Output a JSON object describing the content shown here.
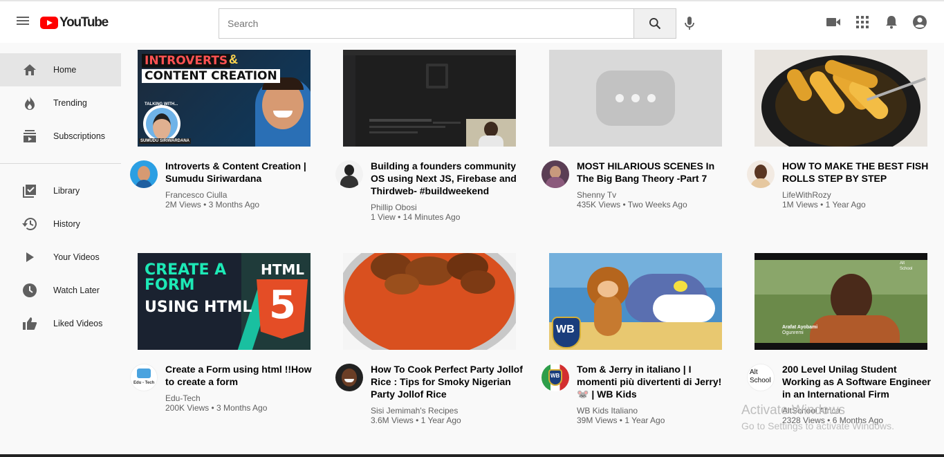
{
  "header": {
    "logo_text": "YouTube",
    "search_placeholder": "Search"
  },
  "sidebar": {
    "items": [
      {
        "label": "Home",
        "icon": "home-icon"
      },
      {
        "label": "Trending",
        "icon": "fire-icon"
      },
      {
        "label": "Subscriptions",
        "icon": "subscriptions-icon"
      },
      {
        "label": "Library",
        "icon": "library-icon"
      },
      {
        "label": "History",
        "icon": "history-icon"
      },
      {
        "label": "Your Videos",
        "icon": "play-icon"
      },
      {
        "label": "Watch Later",
        "icon": "clock-icon"
      },
      {
        "label": "Liked Videos",
        "icon": "thumbs-up-icon"
      }
    ]
  },
  "videos": [
    {
      "title": "Introverts & Content Creation | Sumudu Siriwardana",
      "channel": "Francesco Ciulla",
      "stats": "2M Views • 3 Months Ago"
    },
    {
      "title": "Building a founders community OS using Next JS, Firebase and Thirdweb- #buildweekend",
      "channel": "Phillip Obosi",
      "stats": "1 View • 14 Minutes Ago"
    },
    {
      "title": "MOST HILARIOUS SCENES In The Big Bang Theory -Part 7",
      "channel": "Shenny Tv",
      "stats": "435K Views • Two Weeks Ago"
    },
    {
      "title": "HOW TO MAKE THE BEST FISH ROLLS STEP BY STEP",
      "channel": "LifeWithRozy",
      "stats": "1M Views • 1 Year Ago"
    },
    {
      "title": "Create a Form using html !!How to create a form",
      "channel": "Edu-Tech",
      "stats": "200K Views • 3 Months Ago"
    },
    {
      "title": "How To Cook Perfect Party Jollof Rice : Tips for Smoky Nigerian Party Jollof Rice",
      "channel": "Sisi Jemimah's Recipes",
      "stats": "3.6M Views • 1 Year Ago"
    },
    {
      "title": "Tom & Jerry in italiano | I momenti più divertenti di Jerry! 🐭 | WB Kids",
      "channel": "WB Kids Italiano",
      "stats": "39M Views • 1 Year Ago"
    },
    {
      "title": "200 Level Unilag Student Working as A Software Engineer in an International Firm",
      "channel": "AltSchool Africa",
      "stats": "2328 Views • 6 Months Ago"
    }
  ],
  "thumbnails": {
    "t1_line1": "INTROVERTS",
    "t1_amp": "&",
    "t1_line2": "CONTENT CREATION",
    "t1_talking": "TALKING WITH...",
    "t1_name": "SUMUDU SIRIWARDANA",
    "t5_line1": "CREATE A",
    "t5_line2": "FORM",
    "t5_line3": "USING HTML",
    "t5_html": "HTML",
    "t5_five": "5",
    "t7_logo": "WB",
    "t8_brand1": "Alt",
    "t8_brand2": "School",
    "t8_caption1": "Arafat Ayobami",
    "t8_caption2": "Ogunremi"
  },
  "avatars": {
    "edutech": "Edu - Tech",
    "wb": "WB",
    "alt": "Alt",
    "school": "School"
  },
  "watermark": {
    "line1": "Activate Windows",
    "line2": "Go to Settings to activate Windows."
  }
}
